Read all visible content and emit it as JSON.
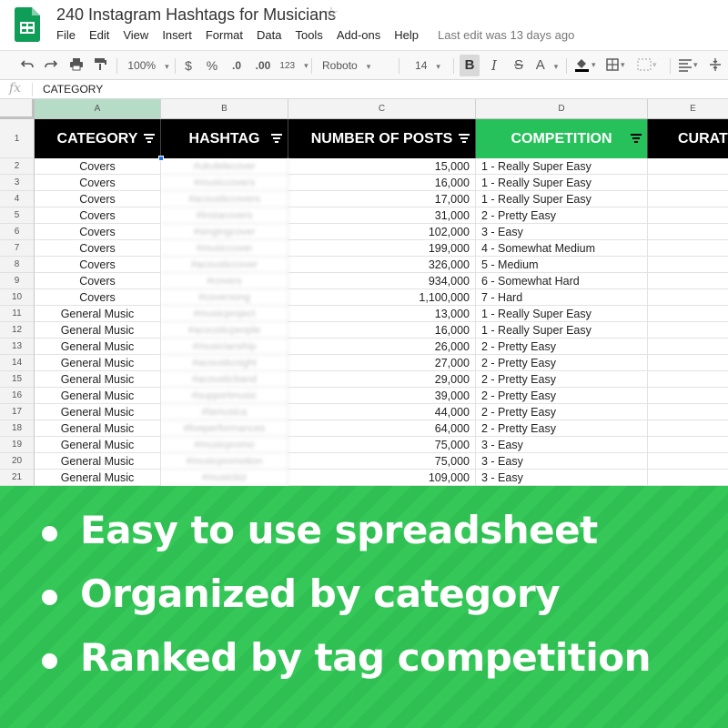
{
  "app": {
    "title": "240 Instagram Hashtags for Musicians",
    "menu": [
      "File",
      "Edit",
      "View",
      "Insert",
      "Format",
      "Data",
      "Tools",
      "Add-ons",
      "Help"
    ],
    "last_edit": "Last edit was 13 days ago",
    "brand_color": "#0f9d58"
  },
  "toolbar": {
    "zoom": "100%",
    "currency": "$",
    "percent": "%",
    "decrease_decimals": ".0",
    "increase_decimals": ".00",
    "number_format": "123",
    "font": "Roboto",
    "font_size": "14",
    "bold": "B",
    "italic": "I",
    "strike": "S",
    "text_color": "A",
    "icons": [
      "undo-icon",
      "redo-icon",
      "print-icon",
      "paint-format-icon",
      "fill-color-icon",
      "borders-icon",
      "merge-cells-icon",
      "align-icon",
      "valign-icon"
    ]
  },
  "formula_bar": {
    "fx": "fx",
    "value": "CATEGORY"
  },
  "grid": {
    "columns": [
      "A",
      "B",
      "C",
      "D",
      "E"
    ],
    "header_row_number": "1",
    "headers": [
      "CATEGORY",
      "HASHTAG",
      "NUMBER OF POSTS",
      "COMPETITION",
      "CURATI"
    ],
    "header_colors": {
      "default": "#000000",
      "competition": "#27c15b"
    },
    "rows": [
      {
        "n": "2",
        "category": "Covers",
        "hashtag": "#ukulelecover",
        "posts": "15,000",
        "competition": "1 - Really Super Easy"
      },
      {
        "n": "3",
        "category": "Covers",
        "hashtag": "#musiccovers",
        "posts": "16,000",
        "competition": "1 - Really Super Easy"
      },
      {
        "n": "4",
        "category": "Covers",
        "hashtag": "#acousticcovers",
        "posts": "17,000",
        "competition": "1 - Really Super Easy"
      },
      {
        "n": "5",
        "category": "Covers",
        "hashtag": "#instacovers",
        "posts": "31,000",
        "competition": "2 - Pretty Easy"
      },
      {
        "n": "6",
        "category": "Covers",
        "hashtag": "#singingcover",
        "posts": "102,000",
        "competition": "3 - Easy"
      },
      {
        "n": "7",
        "category": "Covers",
        "hashtag": "#musiccover",
        "posts": "199,000",
        "competition": "4 - Somewhat Medium"
      },
      {
        "n": "8",
        "category": "Covers",
        "hashtag": "#acousticcover",
        "posts": "326,000",
        "competition": "5 - Medium"
      },
      {
        "n": "9",
        "category": "Covers",
        "hashtag": "#covers",
        "posts": "934,000",
        "competition": "6 - Somewhat Hard"
      },
      {
        "n": "10",
        "category": "Covers",
        "hashtag": "#coversong",
        "posts": "1,100,000",
        "competition": "7 - Hard"
      },
      {
        "n": "11",
        "category": "General Music",
        "hashtag": "#musicproject",
        "posts": "13,000",
        "competition": "1 - Really Super Easy"
      },
      {
        "n": "12",
        "category": "General Music",
        "hashtag": "#acousticpeople",
        "posts": "16,000",
        "competition": "1 - Really Super Easy"
      },
      {
        "n": "13",
        "category": "General Music",
        "hashtag": "#musicianship",
        "posts": "26,000",
        "competition": "2 - Pretty Easy"
      },
      {
        "n": "14",
        "category": "General Music",
        "hashtag": "#acousticnight",
        "posts": "27,000",
        "competition": "2 - Pretty Easy"
      },
      {
        "n": "15",
        "category": "General Music",
        "hashtag": "#acousticband",
        "posts": "29,000",
        "competition": "2 - Pretty Easy"
      },
      {
        "n": "16",
        "category": "General Music",
        "hashtag": "#supportmusic",
        "posts": "39,000",
        "competition": "2 - Pretty Easy"
      },
      {
        "n": "17",
        "category": "General Music",
        "hashtag": "#lamusica",
        "posts": "44,000",
        "competition": "2 - Pretty Easy"
      },
      {
        "n": "18",
        "category": "General Music",
        "hashtag": "#liveperformances",
        "posts": "64,000",
        "competition": "2 - Pretty Easy"
      },
      {
        "n": "19",
        "category": "General Music",
        "hashtag": "#musicpromo",
        "posts": "75,000",
        "competition": "3 - Easy"
      },
      {
        "n": "20",
        "category": "General Music",
        "hashtag": "#musicpromotion",
        "posts": "75,000",
        "competition": "3 - Easy"
      },
      {
        "n": "21",
        "category": "General Music",
        "hashtag": "#musicbiz",
        "posts": "109,000",
        "competition": "3 - Easy"
      }
    ]
  },
  "banner": {
    "background": "#2fbf52",
    "bullets": [
      "Easy to use spreadsheet",
      "Organized by category",
      "Ranked by tag competition"
    ]
  }
}
